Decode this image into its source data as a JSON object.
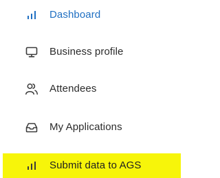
{
  "sidebar": {
    "items": [
      {
        "label": "Dashboard",
        "icon": "bar-chart-icon",
        "active": true
      },
      {
        "label": "Business profile",
        "icon": "monitor-icon",
        "active": false
      },
      {
        "label": "Attendees",
        "icon": "users-icon",
        "active": false
      },
      {
        "label": "My Applications",
        "icon": "inbox-icon",
        "active": false
      },
      {
        "label": "Submit data to AGS",
        "icon": "bar-chart-icon",
        "active": false,
        "highlighted": true
      }
    ],
    "colors": {
      "active": "#1f6fc2",
      "text": "#2b2b2b",
      "icon": "#3a3a3a",
      "highlight": "#f7f50a"
    }
  }
}
